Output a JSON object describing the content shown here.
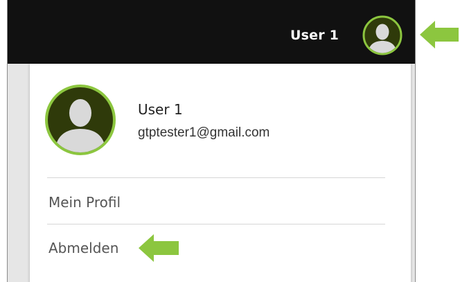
{
  "header": {
    "user_name": "User 1",
    "avatar_icon": "user-avatar-icon"
  },
  "menu": {
    "user_name": "User 1",
    "email": "gtptester1@gmail.com",
    "items": [
      {
        "label": "Mein Profil"
      },
      {
        "label": "Abmelden"
      }
    ]
  },
  "colors": {
    "accent": "#8cc63f",
    "header_bg": "#111111",
    "avatar_bg": "#2f3a0a",
    "avatar_figure": "#d9d9d9"
  },
  "annotations": {
    "arrow_icon": "arrow-left-icon"
  }
}
